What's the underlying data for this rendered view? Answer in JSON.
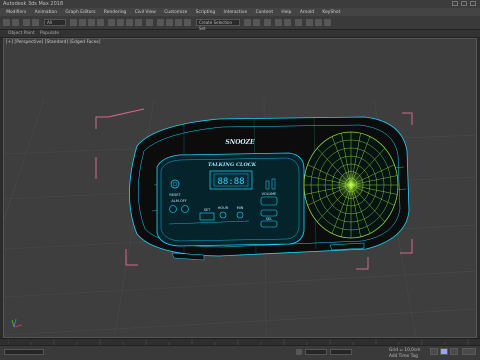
{
  "app": {
    "title": "Autodesk 3ds Max 2018"
  },
  "menu": [
    "Modifiers",
    "Animation",
    "Graph Editors",
    "Rendering",
    "Civil View",
    "Customize",
    "Scripting",
    "Interactive",
    "Content",
    "Help",
    "Arnold",
    "KeyShot"
  ],
  "toolbar": {
    "selection_filter": "All",
    "named_set": "Create Selection Set"
  },
  "ribbon": {
    "tabs": [
      "Object Paint",
      "Populate"
    ]
  },
  "viewport": {
    "label": "[+] [Perspective] [Standard] [Edged Faces]"
  },
  "model": {
    "top_label": "SNOOZE",
    "panel_title": "TALKING CLOCK",
    "display": "88:88",
    "labels": {
      "reset": "RESET",
      "alm_off": "ALM.OFF",
      "set": "SET",
      "hour": "HOUR",
      "min": "MIN",
      "volume": "VOLUME",
      "sel": "SEL"
    }
  },
  "status": {
    "field": "",
    "grid": "Grid = 10,0cm",
    "add_time_tag": "Add Time Tag"
  },
  "colors": {
    "wire_cyan": "#19d9ff",
    "speaker_green": "#b6ff3c",
    "bbox_pink": "#d26b8a",
    "grid_line": "#4a4a4a"
  }
}
